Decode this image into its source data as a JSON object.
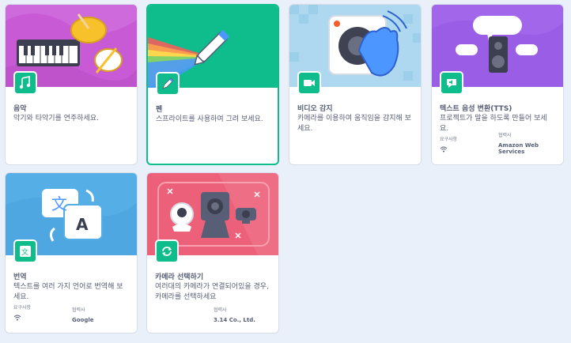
{
  "cards": [
    {
      "title": "음악",
      "description": "악기와 타악기를 연주하세요.",
      "badge_icon": "music-notes-icon",
      "banner_color": "#c95ad6"
    },
    {
      "title": "펜",
      "description": "스프라이트를 사용하여 그려 보세요.",
      "badge_icon": "pen-icon",
      "banner_color": "#0fbd8c",
      "selected": true
    },
    {
      "title": "비디오 감지",
      "description": "카메라를 이용하여 움직임을 감지해 보세요.",
      "badge_icon": "video-camera-icon",
      "banner_color": "#aed8f0"
    },
    {
      "title": "텍스트 음성 변환(TTS)",
      "description": "프로젝트가 말을 하도록 만들어 보세요.",
      "badge_icon": "speaker-icon",
      "banner_color": "#9a5ee6",
      "requirements_label": "요구사항",
      "partner_label": "협력사",
      "partner": "Amazon Web Services",
      "requirement_icon": "wifi-icon"
    },
    {
      "title": "번역",
      "description": "텍스트를 여러 가지 언어로 번역해 보세요.",
      "badge_icon": "translate-icon",
      "banner_color": "#55aee6",
      "requirements_label": "요구사항",
      "partner_label": "협력사",
      "partner": "Google",
      "requirement_icon": "wifi-icon"
    },
    {
      "title": "카메라 선택하기",
      "description": "여러대의 카메라가 연결되어있을 경우, 카메라를 선택하세요",
      "badge_icon": "camera-switch-icon",
      "banner_color": "#ec6079",
      "partner_label": "협력사",
      "partner": "3.14 Co., Ltd."
    }
  ],
  "banner_texts": {
    "translate_glyph_a": "文",
    "translate_glyph_b": "A"
  }
}
